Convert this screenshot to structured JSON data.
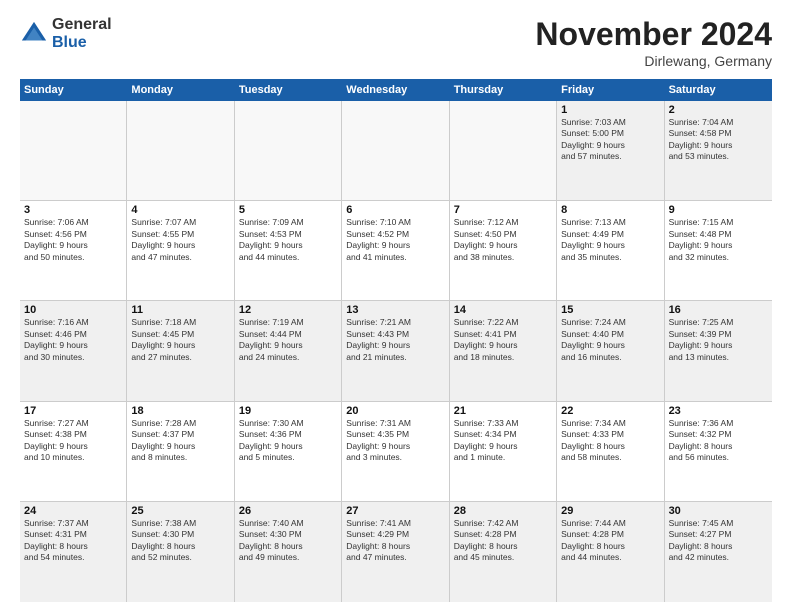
{
  "logo": {
    "general": "General",
    "blue": "Blue"
  },
  "title": "November 2024",
  "location": "Dirlewang, Germany",
  "header_days": [
    "Sunday",
    "Monday",
    "Tuesday",
    "Wednesday",
    "Thursday",
    "Friday",
    "Saturday"
  ],
  "weeks": [
    [
      {
        "day": "",
        "info": "",
        "empty": true
      },
      {
        "day": "",
        "info": "",
        "empty": true
      },
      {
        "day": "",
        "info": "",
        "empty": true
      },
      {
        "day": "",
        "info": "",
        "empty": true
      },
      {
        "day": "",
        "info": "",
        "empty": true
      },
      {
        "day": "1",
        "info": "Sunrise: 7:03 AM\nSunset: 5:00 PM\nDaylight: 9 hours\nand 57 minutes.",
        "empty": false
      },
      {
        "day": "2",
        "info": "Sunrise: 7:04 AM\nSunset: 4:58 PM\nDaylight: 9 hours\nand 53 minutes.",
        "empty": false
      }
    ],
    [
      {
        "day": "3",
        "info": "Sunrise: 7:06 AM\nSunset: 4:56 PM\nDaylight: 9 hours\nand 50 minutes.",
        "empty": false
      },
      {
        "day": "4",
        "info": "Sunrise: 7:07 AM\nSunset: 4:55 PM\nDaylight: 9 hours\nand 47 minutes.",
        "empty": false
      },
      {
        "day": "5",
        "info": "Sunrise: 7:09 AM\nSunset: 4:53 PM\nDaylight: 9 hours\nand 44 minutes.",
        "empty": false
      },
      {
        "day": "6",
        "info": "Sunrise: 7:10 AM\nSunset: 4:52 PM\nDaylight: 9 hours\nand 41 minutes.",
        "empty": false
      },
      {
        "day": "7",
        "info": "Sunrise: 7:12 AM\nSunset: 4:50 PM\nDaylight: 9 hours\nand 38 minutes.",
        "empty": false
      },
      {
        "day": "8",
        "info": "Sunrise: 7:13 AM\nSunset: 4:49 PM\nDaylight: 9 hours\nand 35 minutes.",
        "empty": false
      },
      {
        "day": "9",
        "info": "Sunrise: 7:15 AM\nSunset: 4:48 PM\nDaylight: 9 hours\nand 32 minutes.",
        "empty": false
      }
    ],
    [
      {
        "day": "10",
        "info": "Sunrise: 7:16 AM\nSunset: 4:46 PM\nDaylight: 9 hours\nand 30 minutes.",
        "empty": false
      },
      {
        "day": "11",
        "info": "Sunrise: 7:18 AM\nSunset: 4:45 PM\nDaylight: 9 hours\nand 27 minutes.",
        "empty": false
      },
      {
        "day": "12",
        "info": "Sunrise: 7:19 AM\nSunset: 4:44 PM\nDaylight: 9 hours\nand 24 minutes.",
        "empty": false
      },
      {
        "day": "13",
        "info": "Sunrise: 7:21 AM\nSunset: 4:43 PM\nDaylight: 9 hours\nand 21 minutes.",
        "empty": false
      },
      {
        "day": "14",
        "info": "Sunrise: 7:22 AM\nSunset: 4:41 PM\nDaylight: 9 hours\nand 18 minutes.",
        "empty": false
      },
      {
        "day": "15",
        "info": "Sunrise: 7:24 AM\nSunset: 4:40 PM\nDaylight: 9 hours\nand 16 minutes.",
        "empty": false
      },
      {
        "day": "16",
        "info": "Sunrise: 7:25 AM\nSunset: 4:39 PM\nDaylight: 9 hours\nand 13 minutes.",
        "empty": false
      }
    ],
    [
      {
        "day": "17",
        "info": "Sunrise: 7:27 AM\nSunset: 4:38 PM\nDaylight: 9 hours\nand 10 minutes.",
        "empty": false
      },
      {
        "day": "18",
        "info": "Sunrise: 7:28 AM\nSunset: 4:37 PM\nDaylight: 9 hours\nand 8 minutes.",
        "empty": false
      },
      {
        "day": "19",
        "info": "Sunrise: 7:30 AM\nSunset: 4:36 PM\nDaylight: 9 hours\nand 5 minutes.",
        "empty": false
      },
      {
        "day": "20",
        "info": "Sunrise: 7:31 AM\nSunset: 4:35 PM\nDaylight: 9 hours\nand 3 minutes.",
        "empty": false
      },
      {
        "day": "21",
        "info": "Sunrise: 7:33 AM\nSunset: 4:34 PM\nDaylight: 9 hours\nand 1 minute.",
        "empty": false
      },
      {
        "day": "22",
        "info": "Sunrise: 7:34 AM\nSunset: 4:33 PM\nDaylight: 8 hours\nand 58 minutes.",
        "empty": false
      },
      {
        "day": "23",
        "info": "Sunrise: 7:36 AM\nSunset: 4:32 PM\nDaylight: 8 hours\nand 56 minutes.",
        "empty": false
      }
    ],
    [
      {
        "day": "24",
        "info": "Sunrise: 7:37 AM\nSunset: 4:31 PM\nDaylight: 8 hours\nand 54 minutes.",
        "empty": false
      },
      {
        "day": "25",
        "info": "Sunrise: 7:38 AM\nSunset: 4:30 PM\nDaylight: 8 hours\nand 52 minutes.",
        "empty": false
      },
      {
        "day": "26",
        "info": "Sunrise: 7:40 AM\nSunset: 4:30 PM\nDaylight: 8 hours\nand 49 minutes.",
        "empty": false
      },
      {
        "day": "27",
        "info": "Sunrise: 7:41 AM\nSunset: 4:29 PM\nDaylight: 8 hours\nand 47 minutes.",
        "empty": false
      },
      {
        "day": "28",
        "info": "Sunrise: 7:42 AM\nSunset: 4:28 PM\nDaylight: 8 hours\nand 45 minutes.",
        "empty": false
      },
      {
        "day": "29",
        "info": "Sunrise: 7:44 AM\nSunset: 4:28 PM\nDaylight: 8 hours\nand 44 minutes.",
        "empty": false
      },
      {
        "day": "30",
        "info": "Sunrise: 7:45 AM\nSunset: 4:27 PM\nDaylight: 8 hours\nand 42 minutes.",
        "empty": false
      }
    ]
  ]
}
